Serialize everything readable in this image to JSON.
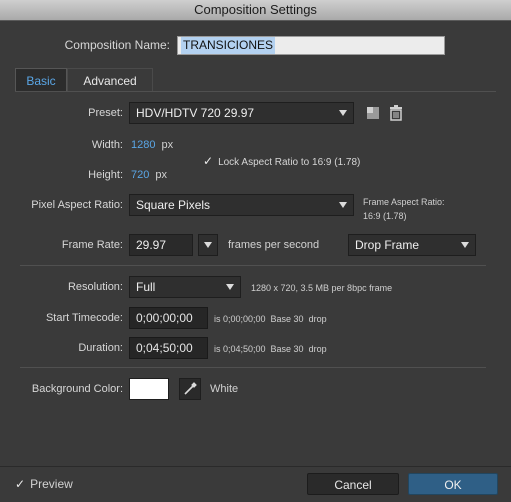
{
  "window": {
    "title": "Composition Settings"
  },
  "name_field": {
    "label": "Composition Name:",
    "value": "TRANSICIONES"
  },
  "tabs": [
    {
      "label": "Basic"
    },
    {
      "label": "Advanced"
    }
  ],
  "preset": {
    "label": "Preset:",
    "value": "HDV/HDTV 720 29.97"
  },
  "width": {
    "label": "Width:",
    "value": "1280",
    "unit": "px"
  },
  "height": {
    "label": "Height:",
    "value": "720",
    "unit": "px"
  },
  "lock_aspect": {
    "checked": true,
    "label": "Lock Aspect Ratio to 16:9 (1.78)"
  },
  "pixel_aspect": {
    "label": "Pixel Aspect Ratio:",
    "value": "Square Pixels",
    "frame_aspect_label": "Frame Aspect Ratio:",
    "frame_aspect_value": "16:9 (1.78)"
  },
  "frame_rate": {
    "label": "Frame Rate:",
    "value": "29.97",
    "unit": "frames per second",
    "drop_value": "Drop Frame"
  },
  "resolution": {
    "label": "Resolution:",
    "value": "Full",
    "info": "1280 x 720, 3.5 MB per 8bpc frame"
  },
  "start_timecode": {
    "label": "Start Timecode:",
    "value": "0;00;00;00",
    "info": "is 0;00;00;00  Base 30  drop"
  },
  "duration": {
    "label": "Duration:",
    "value": "0;04;50;00",
    "info": "is 0;04;50;00  Base 30  drop"
  },
  "background": {
    "label": "Background Color:",
    "color_name": "White",
    "swatch": "#ffffff"
  },
  "footer": {
    "preview_label": "Preview",
    "preview_checked": true,
    "cancel_label": "Cancel",
    "ok_label": "OK"
  },
  "colors": {
    "accent": "#5aa6e6",
    "ok_button": "#2f5f86"
  }
}
